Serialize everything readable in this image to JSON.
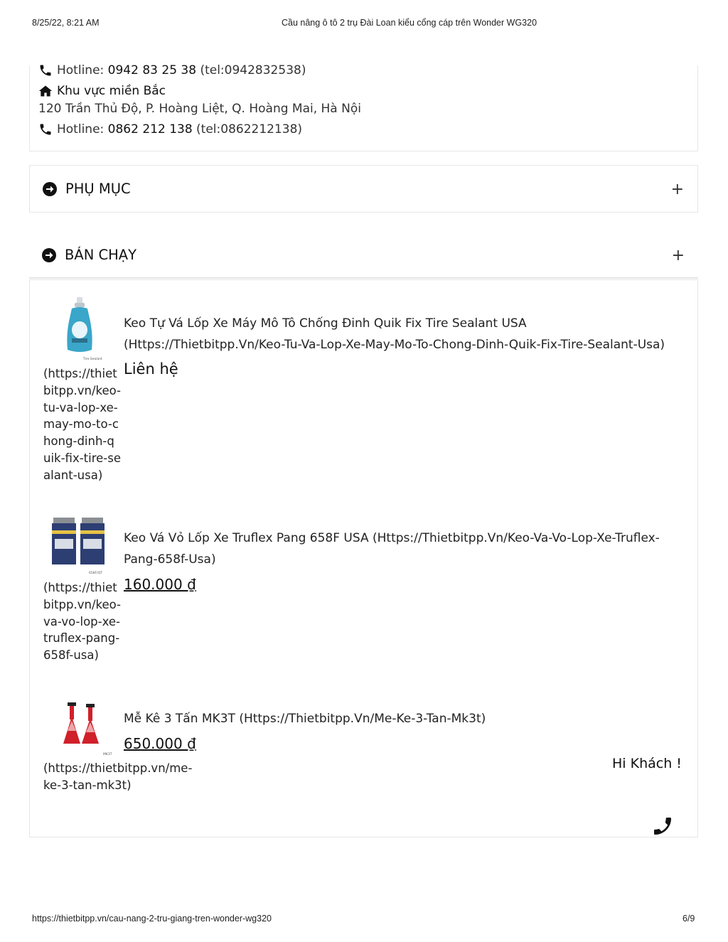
{
  "print_header": {
    "datetime": "8/25/22, 8:21 AM",
    "title": "Cầu nâng ô tô 2 trụ Đài Loan kiểu cổng cáp trên Wonder WG320"
  },
  "contact": {
    "hotline1_label": "Hotline:",
    "hotline1_number": "0942 83 25 38",
    "hotline1_tel": "(tel:0942832538)",
    "region_title": "Khu vực miền Bắc",
    "address": "120 Trần Thủ Độ, P. Hoàng Liệt, Q. Hoàng Mai, Hà Nội",
    "hotline2_label": "Hotline:",
    "hotline2_number": "0862 212 138",
    "hotline2_tel": "(tel:0862212138)"
  },
  "sections": {
    "phu_muc": "PHỤ MỤC",
    "ban_chay": "BÁN CHẠY",
    "expand_symbol": "+"
  },
  "products": [
    {
      "name": "Keo Tự Vá Lốp Xe Máy Mô Tô Chống Đinh Quik Fix Tire Sealant USA (Https://Thietbitpp.Vn/Keo-Tu-Va-Lop-Xe-May-Mo-To-Chong-Dinh-Quik-Fix-Tire-Sealant-Usa)",
      "price": "Liên hệ",
      "link": "(https://thietbitpp.vn/keo-tu-va-lop-xe-may-mo-to-chong-dinh-quik-fix-tire-sealant-usa)",
      "image_caption": "Tire Sealant"
    },
    {
      "name": "Keo Vá Vỏ Lốp Xe Truflex Pang 658F USA (Https://Thietbitpp.Vn/Keo-Va-Vo-Lop-Xe-Truflex-Pang-658f-Usa)",
      "price": "160.000 ₫",
      "link": "(https://thietbitpp.vn/keo-va-vo-lop-xe-truflex-pang-658f-usa)",
      "image_caption": "658F/QT"
    },
    {
      "name": "Mễ Kê 3 Tấn MK3T (Https://Thietbitpp.Vn/Me-Ke-3-Tan-Mk3t)",
      "price": "650.000 ₫",
      "link": "(https://thietbitpp.vn/me-ke-3-tan-mk3t)",
      "image_caption": "MK3T"
    }
  ],
  "chat": {
    "greeting": "Hi Khách !"
  },
  "print_footer": {
    "url": "https://thietbitpp.vn/cau-nang-2-tru-giang-tren-wonder-wg320",
    "page": "6/9"
  },
  "colors": {
    "border": "#e6e6e6",
    "bottle_blue": "#3aa6c9",
    "jack_red": "#d0202a"
  }
}
